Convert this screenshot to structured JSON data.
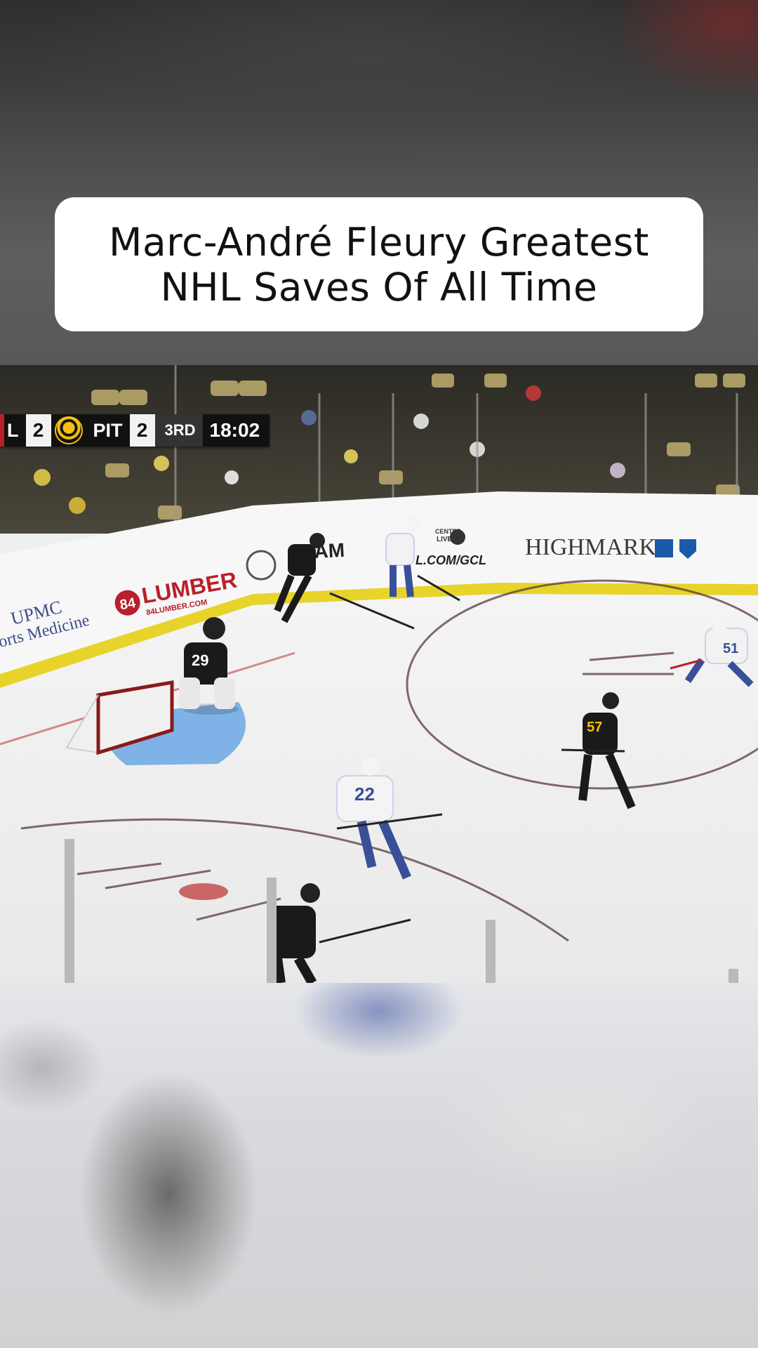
{
  "title_card": {
    "text": "Marc-André Fleury Greatest\nNHL Saves Of All Time"
  },
  "scorebug": {
    "away_team": "L",
    "away_score": "2",
    "home_logo": "penguins-logo-icon",
    "home_team": "PIT",
    "home_score": "2",
    "period": "3RD",
    "clock": "18:02"
  },
  "rink_boards": {
    "upmc_line1": "UPMC",
    "upmc_line2": "orts Medicine",
    "lumber_badge": "84",
    "lumber_name": "LUMBER",
    "lumber_url": "84LUMBER.COM",
    "ram_text": "AM",
    "gcl_line1": "CENTER",
    "gcl_line2": "LIVE",
    "gcl_url": "L.COM/GCL",
    "highmark": "HIGHMARK"
  },
  "players": {
    "goalie_number": "29",
    "defender_number": "22",
    "forward_number": "51",
    "skater_number": "57"
  },
  "colors": {
    "penguins_black": "#111111",
    "penguins_gold": "#f6c10e",
    "canadiens_red": "#b8202a",
    "crease_blue": "#7fb2e6",
    "highmark_blue": "#1b5aa8"
  }
}
